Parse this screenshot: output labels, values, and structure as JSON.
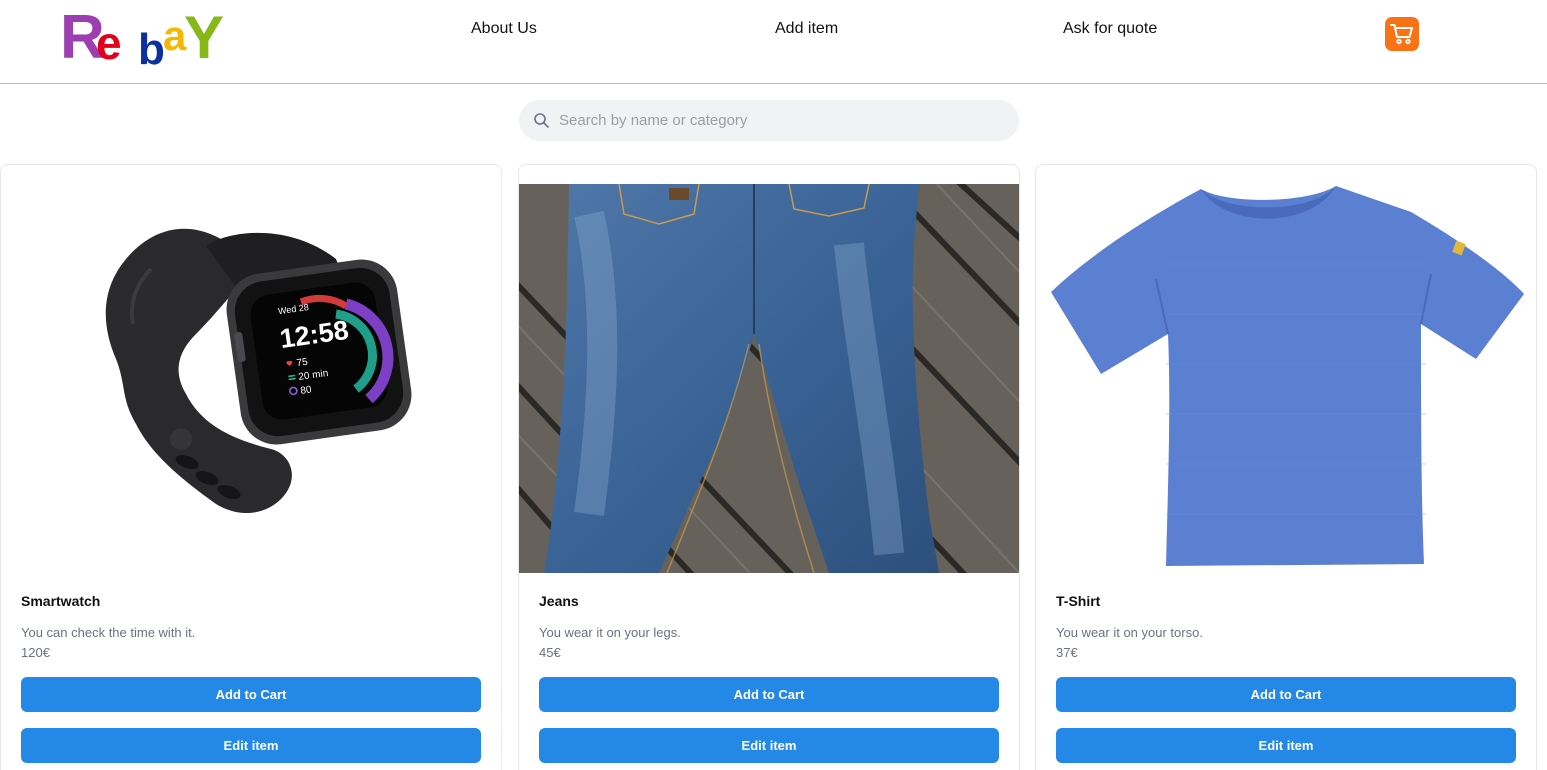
{
  "brand": {
    "letters": [
      "R",
      "e",
      "b",
      "a",
      "Y"
    ],
    "colors": [
      "#9b3fb0",
      "#e3001b",
      "#0a2f9f",
      "#f5b800",
      "#86b817"
    ]
  },
  "nav": {
    "about": "About Us",
    "add_item": "Add item",
    "quote": "Ask for quote",
    "cart_icon": "shopping-cart-icon",
    "cart_color": "#f97316"
  },
  "search": {
    "placeholder": "Search by name or category",
    "value": "",
    "icon": "search-icon"
  },
  "products": [
    {
      "name": "Smartwatch",
      "description": "You can check the time with it.",
      "price": "120€",
      "image": "smartwatch",
      "watch_face": {
        "date": "Wed 28",
        "time": "12:58",
        "heart": "75",
        "active": "20 min",
        "sleep": "80"
      }
    },
    {
      "name": "Jeans",
      "description": "You wear it on your legs.",
      "price": "45€",
      "image": "jeans"
    },
    {
      "name": "T-Shirt",
      "description": "You wear it on your torso.",
      "price": "37€",
      "image": "t-shirt"
    }
  ],
  "buttons": {
    "add_to_cart": "Add to Cart",
    "edit_item": "Edit item",
    "color": "#2388e6"
  }
}
